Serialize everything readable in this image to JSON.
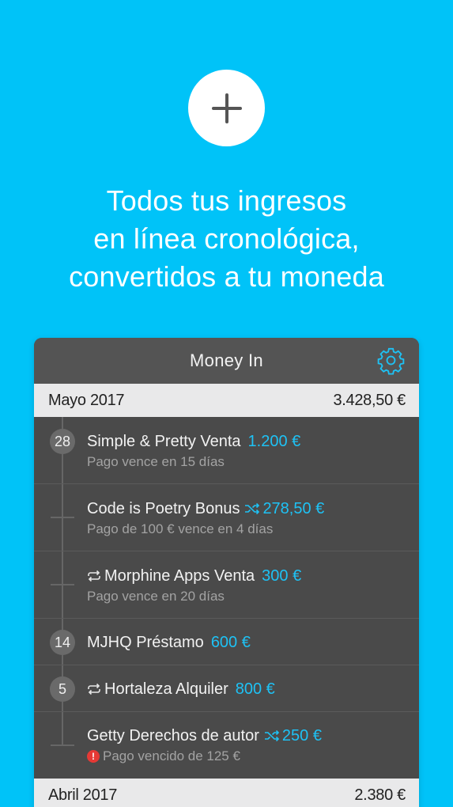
{
  "add_button": {
    "icon": "plus-icon"
  },
  "headline": {
    "line1": "Todos tus ingresos",
    "line2": "en línea cronológica,",
    "line3": "convertidos a tu moneda"
  },
  "app": {
    "title": "Money In",
    "settings_icon": "gear-icon",
    "accent_color": "#1ec2f5",
    "months": [
      {
        "label": "Mayo 2017",
        "total": "3.428,50 €"
      },
      {
        "label": "Abril 2017",
        "total": "2.380 €"
      }
    ],
    "items": [
      {
        "day": "28",
        "name": "Simple & Pretty Venta",
        "amount": "1.200 €",
        "note": "Pago vence en 15 días"
      },
      {
        "day": "",
        "name": "Code is Poetry Bonus",
        "amount": "278,50 €",
        "note": "Pago de 100 € vence en 4 días",
        "icon": "shuffle-icon"
      },
      {
        "day": "",
        "name": "Morphine Apps Venta",
        "amount": "300 €",
        "note": "Pago vence en 20 días",
        "icon": "repeat-icon"
      },
      {
        "day": "14",
        "name": "MJHQ Préstamo",
        "amount": "600 €"
      },
      {
        "day": "5",
        "name": "Hortaleza Alquiler",
        "amount": "800 €",
        "icon": "repeat-icon"
      },
      {
        "day": "",
        "name": "Getty Derechos de autor",
        "amount": "250 €",
        "note": "Pago vencido de 125 €",
        "icon": "shuffle-icon",
        "note_icon": "alert-icon"
      }
    ]
  }
}
